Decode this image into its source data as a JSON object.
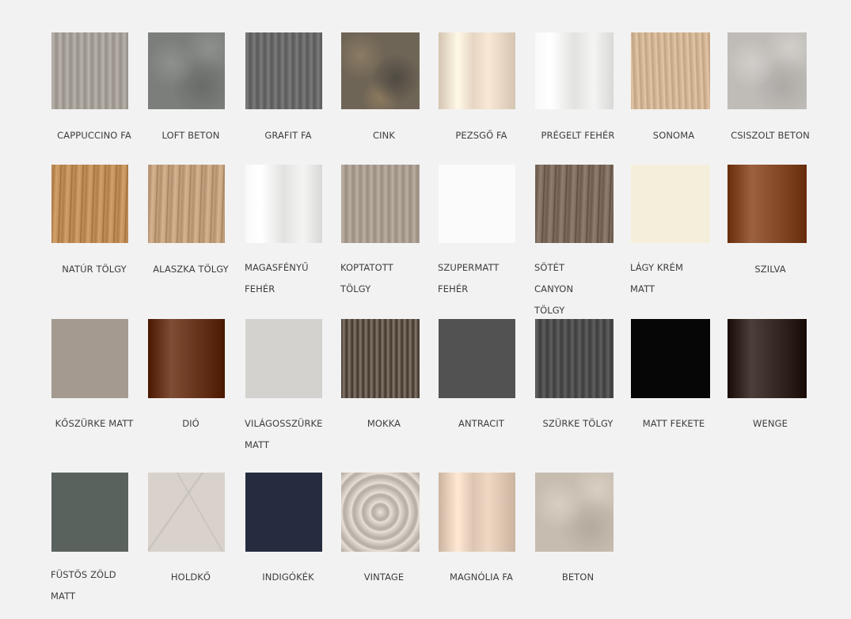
{
  "swatches": [
    {
      "label": "CAPPUCCINO FA",
      "color": "#a8a29b",
      "texture": "wood-fine",
      "lines": 1
    },
    {
      "label": "LOFT BETON",
      "color": "#7b7e7b",
      "texture": "concrete",
      "lines": 1
    },
    {
      "label": "GRAFIT FA",
      "color": "#6b6b6b",
      "texture": "wood-fine",
      "lines": 1
    },
    {
      "label": "CINK",
      "color": "#6f6556",
      "texture": "rust",
      "lines": 1
    },
    {
      "label": "PEZSGŐ FA",
      "color": "#e6d6c3",
      "texture": "gloss-vertical",
      "lines": 1
    },
    {
      "label": "PRÉGELT FEHÉR",
      "color": "#e7e8e6",
      "texture": "gloss-white",
      "lines": 1
    },
    {
      "label": "SONOMA",
      "color": "#d2b594",
      "texture": "wood-light",
      "lines": 1
    },
    {
      "label": "CSISZOLT BETON",
      "color": "#bfbcb8",
      "texture": "concrete",
      "lines": 1
    },
    {
      "label": "NATÚR TÖLGY",
      "color": "#c18f5a",
      "texture": "wood-oak",
      "lines": 1
    },
    {
      "label": "ALASZKA TÖLGY",
      "color": "#c4a27f",
      "texture": "wood-oak",
      "lines": 1
    },
    {
      "label": "MAGASFÉNYŰ FEHÉR",
      "color": "#eeeeee",
      "texture": "gloss-white",
      "lines": 2
    },
    {
      "label": "KOPTATOTT TÖLGY",
      "color": "#ab9f92",
      "texture": "wood-fine",
      "lines": 2
    },
    {
      "label": "SZUPERMATT FEHÉR",
      "color": "#fbfbfb",
      "texture": "plain",
      "lines": 2
    },
    {
      "label": "SÖTÉT CANYON TÖLGY",
      "color": "#7e6d5f",
      "texture": "wood-oak",
      "lines": 2
    },
    {
      "label": "LÁGY KRÉM MATT",
      "color": "#f5eedb",
      "texture": "plain",
      "lines": 2
    },
    {
      "label": "SZILVA",
      "color": "#8a4f2c",
      "texture": "gloss-dark",
      "lines": 1
    },
    {
      "label": "KŐSZÜRKE MATT",
      "color": "#a49a90",
      "texture": "plain",
      "lines": 1
    },
    {
      "label": "DIÓ",
      "color": "#6d3a22",
      "texture": "gloss-dark",
      "lines": 1
    },
    {
      "label": "VILÁGOSSZÜRKE MATT",
      "color": "#d3d2cf",
      "texture": "plain",
      "lines": 2
    },
    {
      "label": "MOKKA",
      "color": "#62564b",
      "texture": "ribbed",
      "lines": 1
    },
    {
      "label": "ANTRACIT",
      "color": "#525252",
      "texture": "plain",
      "lines": 1
    },
    {
      "label": "SZÜRKE TÖLGY",
      "color": "#4f4f4f",
      "texture": "wood-fine",
      "lines": 1
    },
    {
      "label": "MATT FEKETE",
      "color": "#060606",
      "texture": "plain",
      "lines": 1
    },
    {
      "label": "WENGE",
      "color": "#3a2c27",
      "texture": "gloss-dark",
      "lines": 1
    },
    {
      "label": "FÜSTÖS ZÖLD MATT",
      "color": "#5a625e",
      "texture": "plain",
      "lines": 2
    },
    {
      "label": "HOLDKŐ",
      "color": "#d8d2cb",
      "texture": "marble",
      "lines": 1
    },
    {
      "label": "INDIGÓKÉK",
      "color": "#262c3f",
      "texture": "plain",
      "lines": 1
    },
    {
      "label": "VINTAGE",
      "color": "#c8c0b6",
      "texture": "pattern",
      "lines": 1
    },
    {
      "label": "MAGNÓLIA FA",
      "color": "#dcc6b1",
      "texture": "gloss-vertical",
      "lines": 1
    },
    {
      "label": "BETON",
      "color": "#c6bcb0",
      "texture": "concrete",
      "lines": 1
    }
  ]
}
